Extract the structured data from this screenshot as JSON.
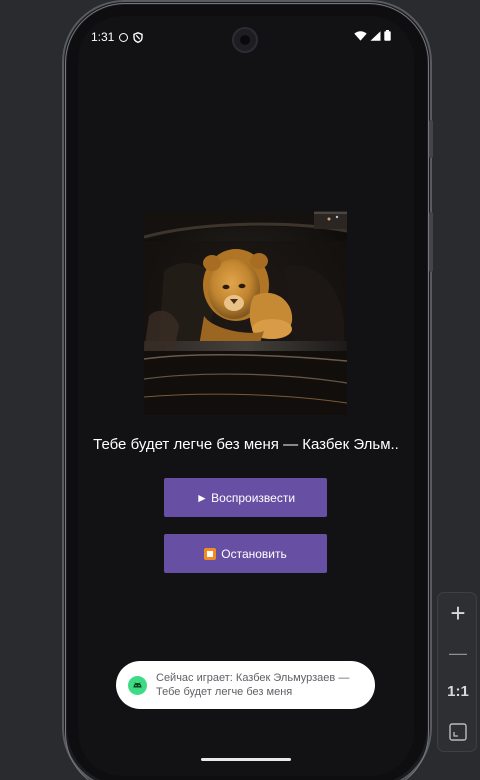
{
  "status_bar": {
    "time": "1:31",
    "icons": [
      "info-icon",
      "shield-icon",
      "wifi-icon",
      "signal-icon",
      "battery-icon"
    ]
  },
  "player": {
    "album_art_alt": "lion cub in car window",
    "track_title": "Тебе будет легче без меня — Казбек Эльм..",
    "play_button_label": "► Воспроизвести",
    "stop_button_label": "Остановить",
    "stop_icon": "stop-button-emoji-icon"
  },
  "toast": {
    "icon": "android-icon",
    "text": "Сейчас играет: Казбек Эльмурзаев — Тебе будет легче без меня"
  },
  "emulator_controls": {
    "zoom_in": "+",
    "zoom_out": "—",
    "actual_size": "1:1",
    "fit_screen_icon": "fit-screen-icon"
  },
  "colors": {
    "accent": "#6750a4",
    "screen_bg": "#121214",
    "toast_bg": "#ffffff",
    "toast_icon": "#3ddc84"
  }
}
